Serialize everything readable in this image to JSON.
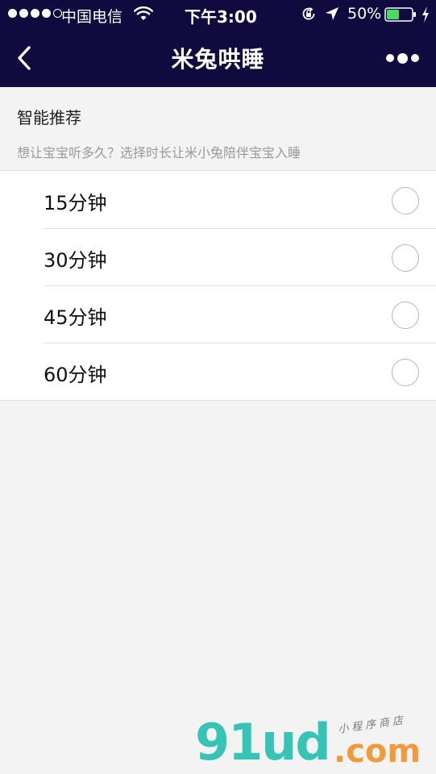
{
  "status_bar": {
    "carrier": "中国电信",
    "time": "下午3:00",
    "battery": "50%",
    "battery_level": 0.5,
    "signal_icon": "signal-dots-icon",
    "wifi_icon": "wifi-icon",
    "orientation_lock_icon": "orientation-lock-icon",
    "location_icon": "location-arrow-icon",
    "charging_icon": "charging-bolt-icon"
  },
  "nav": {
    "title": "米兔哄睡",
    "back_icon": "chevron-left-icon",
    "more_icon": "more-dots-icon"
  },
  "section": {
    "title": "智能推荐",
    "description": "想让宝宝听多久？选择时长让米小兔陪伴宝宝入睡"
  },
  "options": [
    {
      "label": "15分钟",
      "selected": false
    },
    {
      "label": "30分钟",
      "selected": false
    },
    {
      "label": "45分钟",
      "selected": false
    },
    {
      "label": "60分钟",
      "selected": false
    }
  ],
  "watermark": {
    "logo": "91ud",
    "domain": ".com",
    "tagline": "小程序商店"
  },
  "colors": {
    "nav_background": "#0f0b3f",
    "page_background": "#f3f3f3",
    "battery_green": "#4cd964",
    "logo_teal": "#35c4b5",
    "logo_orange": "#f29a3a"
  }
}
